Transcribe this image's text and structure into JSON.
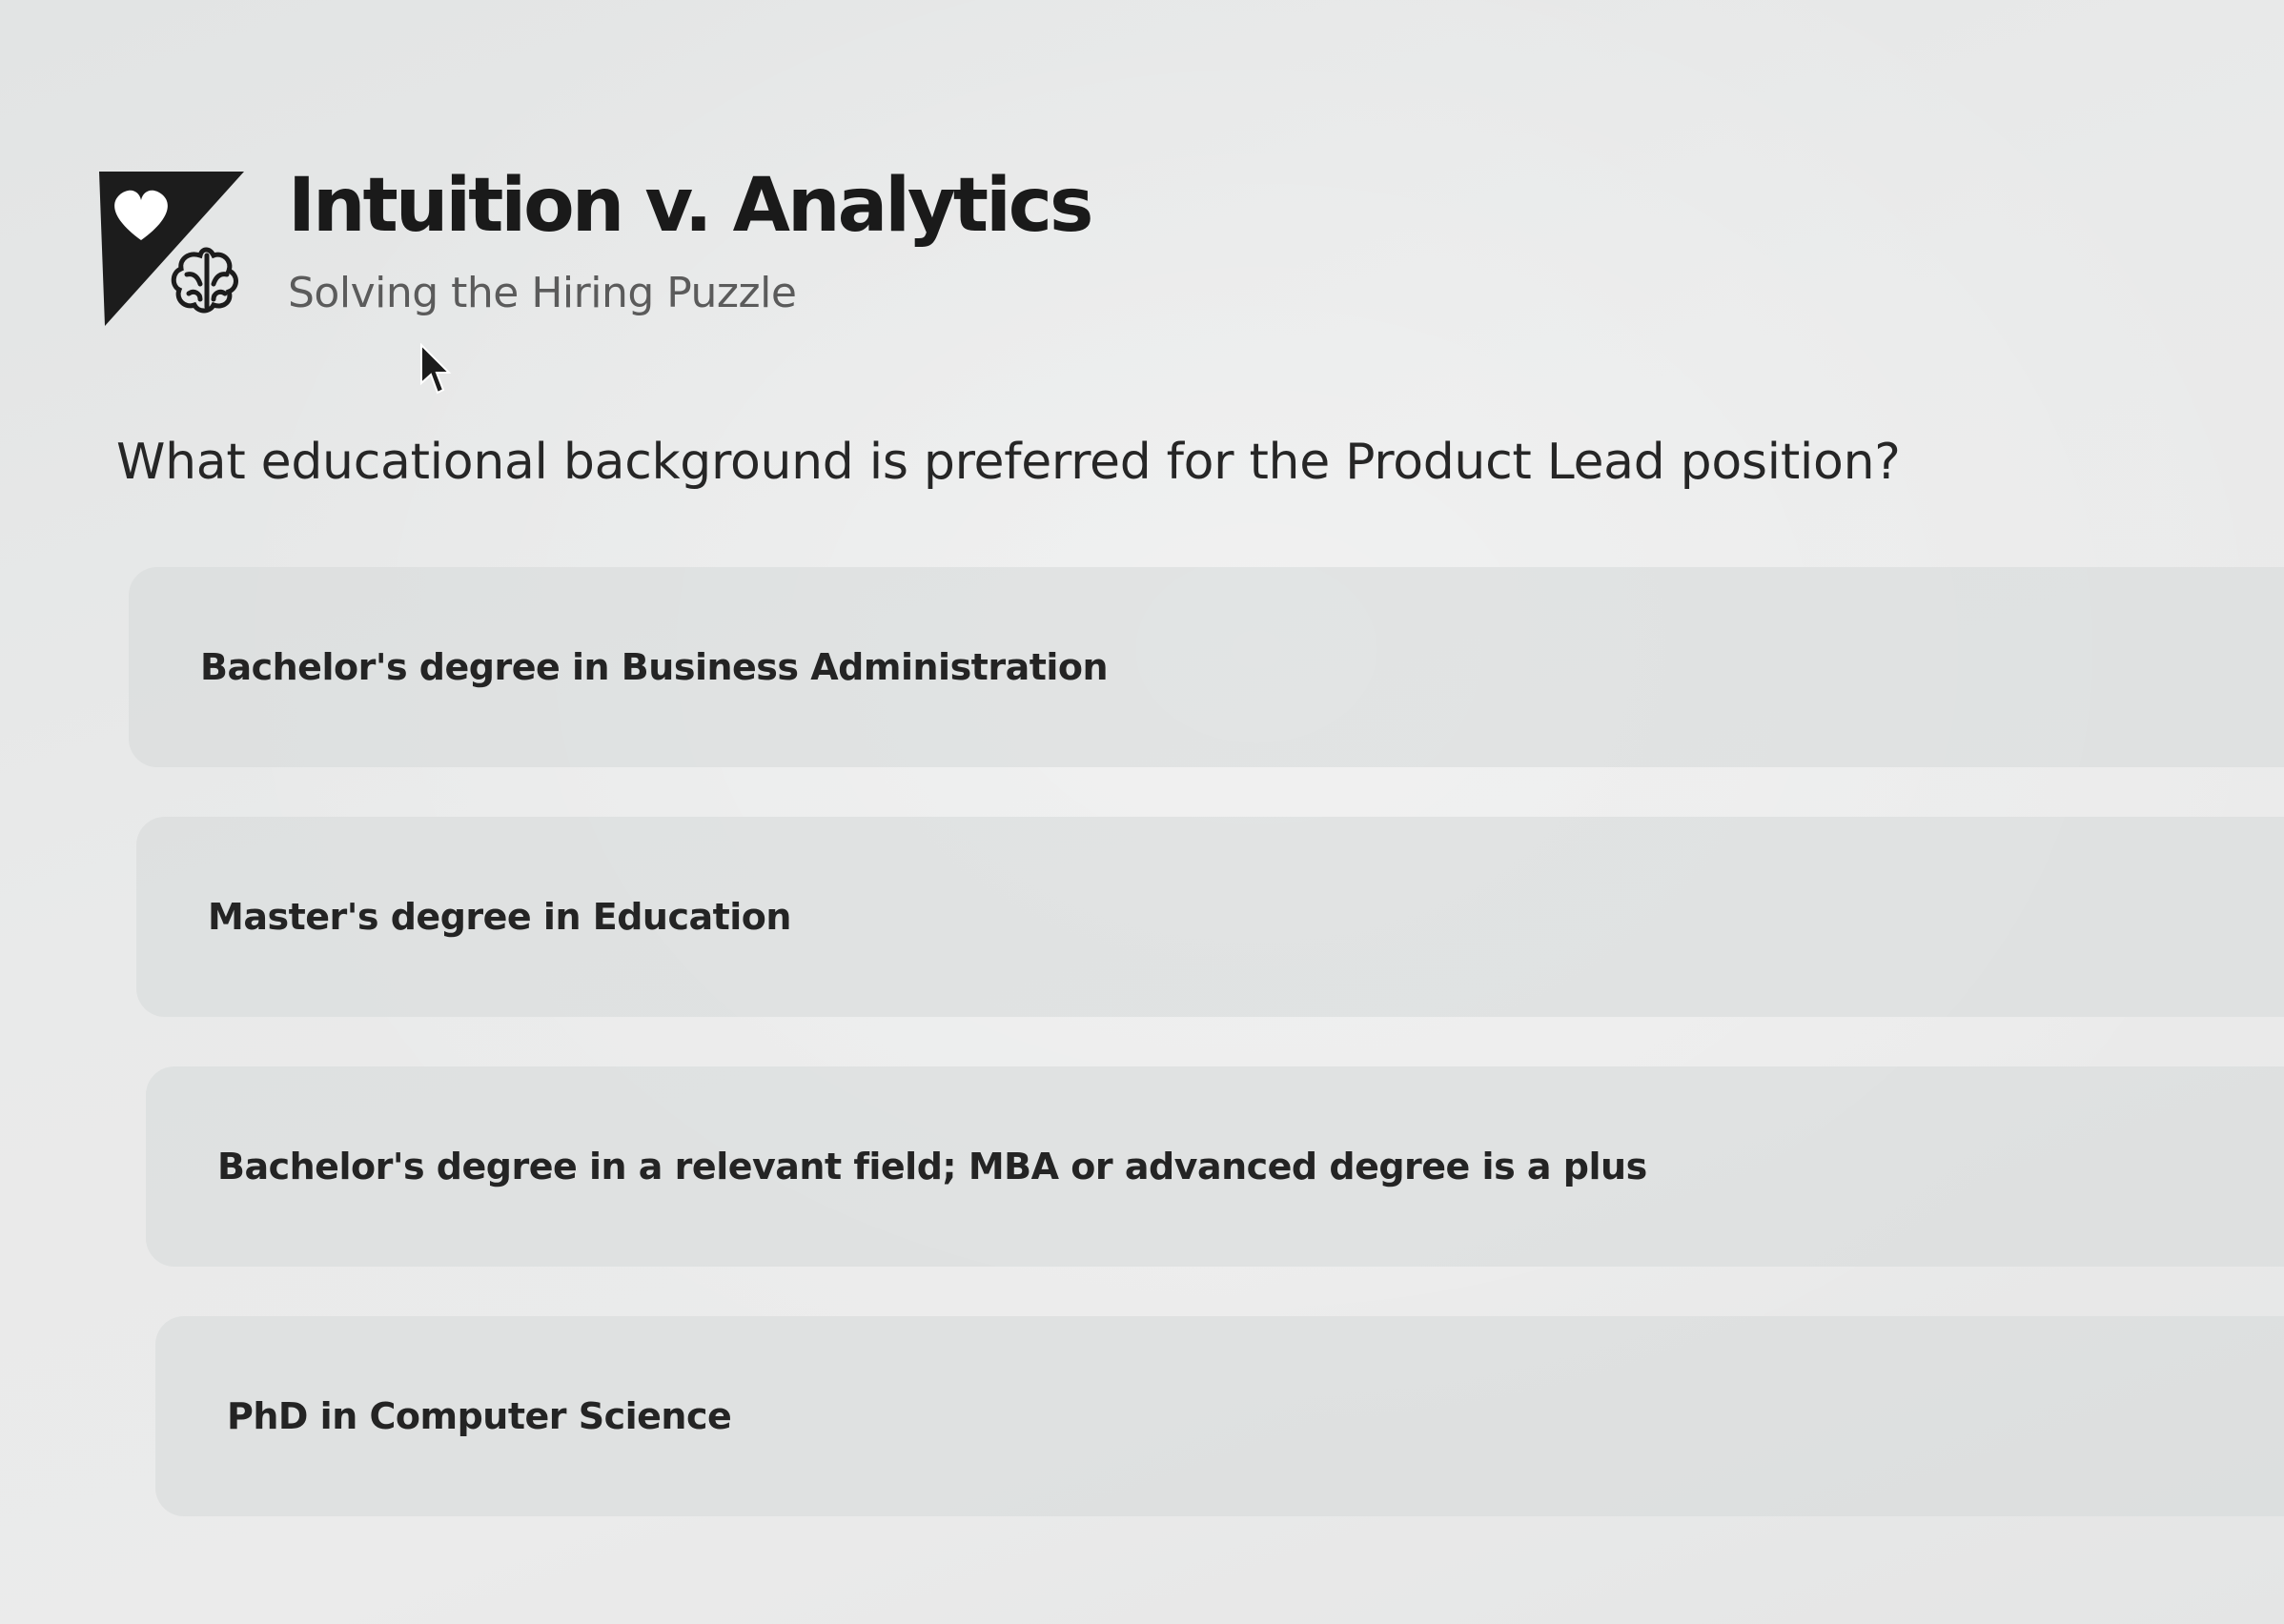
{
  "brand": {
    "title": "Intuition v. Analytics",
    "subtitle": "Solving the Hiring Puzzle",
    "logo_icons": [
      "heart-icon",
      "brain-icon"
    ]
  },
  "question": {
    "text": "What educational background is preferred for the Product Lead position?"
  },
  "options": [
    {
      "label": "Bachelor's degree in Business Administration"
    },
    {
      "label": "Master's degree in Education"
    },
    {
      "label": "Bachelor's degree in a relevant field; MBA or advanced degree is a plus"
    },
    {
      "label": "PhD in Computer Science"
    }
  ],
  "colors": {
    "background": "#e8e9e9",
    "option_background": "#d6d9d9",
    "title_text": "#1a1a1a",
    "subtitle_text": "#5b5b5b"
  }
}
